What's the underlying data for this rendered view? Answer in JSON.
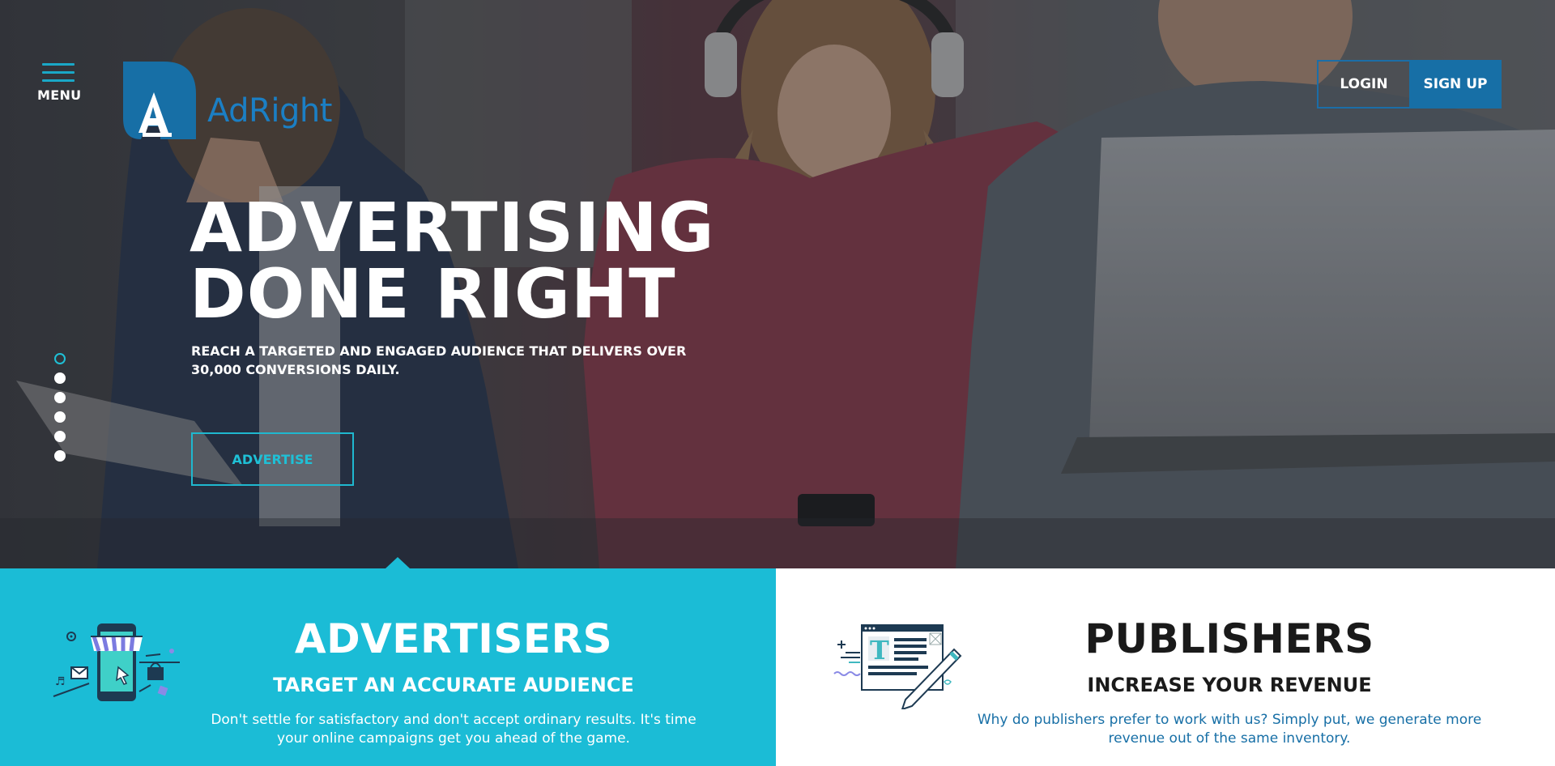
{
  "nav": {
    "menu_label": "MENU",
    "logo_text": "AdRight",
    "login_label": "LOGIN",
    "signup_label": "SIGN UP"
  },
  "hero": {
    "headline_line1": "ADVERTISING",
    "headline_line2": "DONE RIGHT",
    "subline": "REACH A TARGETED AND ENGAGED AUDIENCE THAT DELIVERS OVER 30,000 CONVERSIONS DAILY.",
    "cta_label": "ADVERTISE",
    "slides": 6,
    "active_slide": 1
  },
  "advertisers": {
    "title": "ADVERTISERS",
    "subtitle": "TARGET AN ACCURATE AUDIENCE",
    "description": "Don't settle for satisfactory and don't accept ordinary results. It's time your online campaigns get you ahead of the game."
  },
  "publishers": {
    "title": "PUBLISHERS",
    "subtitle": "INCREASE YOUR REVENUE",
    "description": "Why do publishers prefer to work with us? Simply put, we generate more revenue out of the same inventory."
  },
  "colors": {
    "brand_blue": "#176fa6",
    "accent_cyan": "#1bbcd6",
    "logo_blue": "#1b7fc4"
  },
  "icons": {
    "menu": "hamburger-icon",
    "logo": "adright-logo-mark",
    "advertisers": "mobile-storefront-illustration",
    "publishers": "editor-pencil-illustration"
  }
}
